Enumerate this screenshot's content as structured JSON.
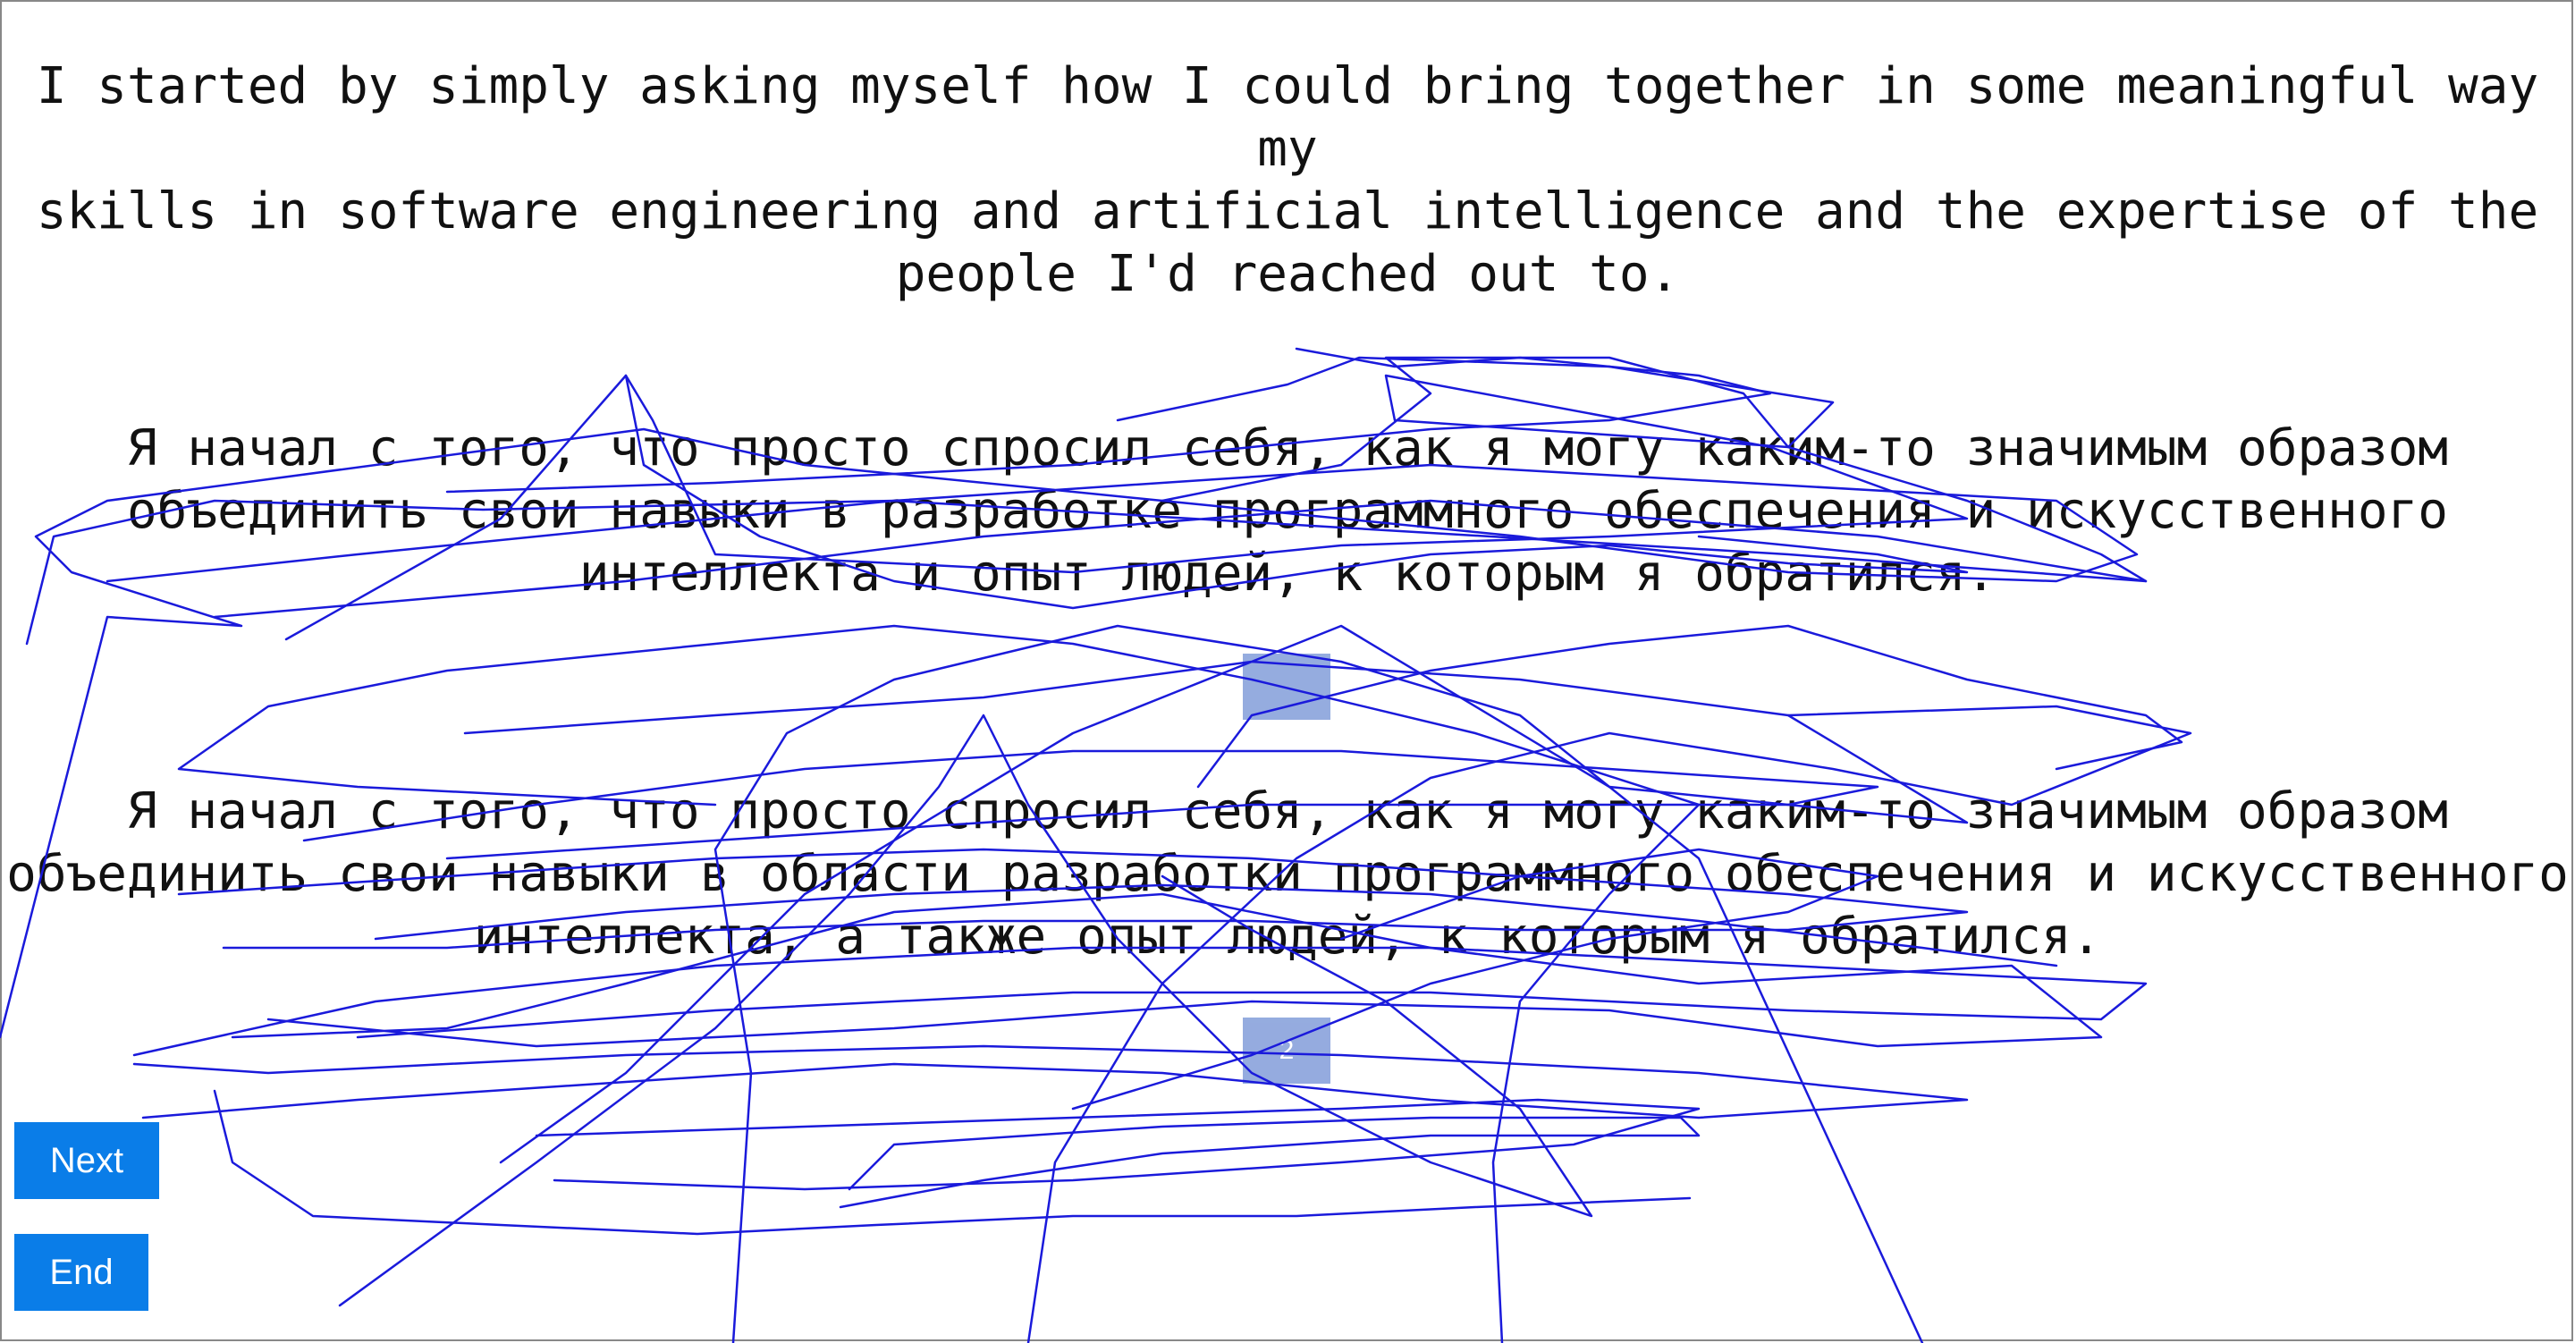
{
  "source": {
    "text": "I started by simply asking myself how I could bring together in some meaningful way my\nskills in software engineering and artificial intelligence and the expertise of the\npeople I'd reached out to."
  },
  "translations": [
    {
      "text": "Я начал с того, что просто спросил себя, как я могу каким-то значимым образом\nобъединить свои навыки в разработке программного обеспечения и искусственного\nинтеллекта и опыт людей, к которым я обратился.",
      "rank": ""
    },
    {
      "text": "Я начал с того, что просто спросил себя, как я могу каким-то значимым образом\nобъединить свои навыки в области разработки программного обеспечения и искусственного\nинтеллекта, а также опыт людей, к которым я обратился.",
      "rank": "2"
    }
  ],
  "buttons": {
    "next_label": "Next",
    "end_label": "End"
  },
  "colors": {
    "button": "#0a7de8",
    "rank_box": "#8aa3dc",
    "scribble": "#1a1adb"
  }
}
